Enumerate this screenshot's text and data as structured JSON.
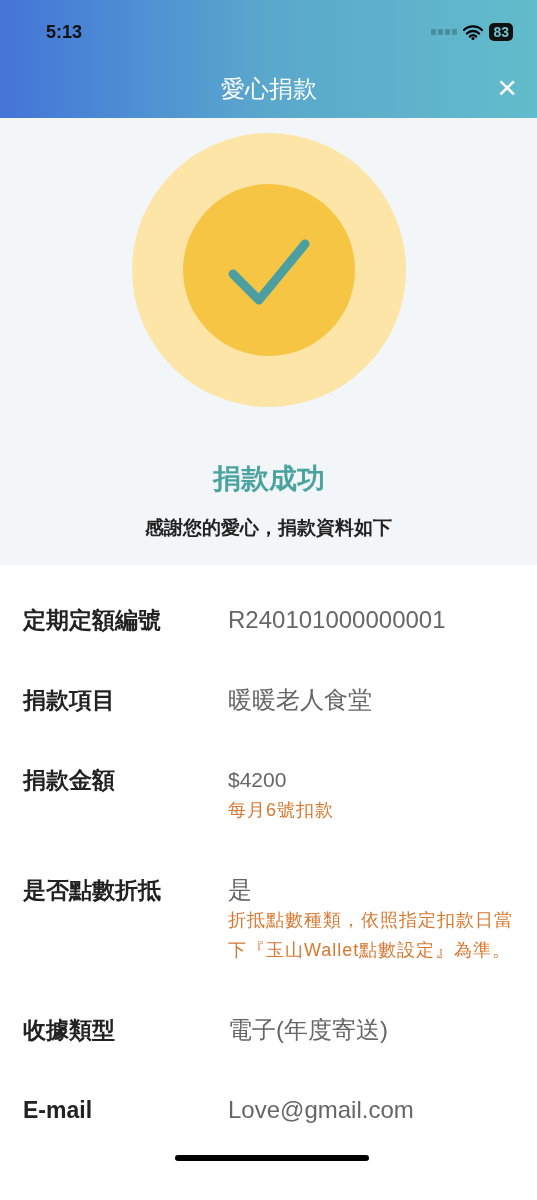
{
  "status_bar": {
    "time": "5:13",
    "battery": "83"
  },
  "header": {
    "title": "愛心捐款",
    "close": "×"
  },
  "result": {
    "title": "捐款成功",
    "message": "感謝您的愛心，捐款資料如下"
  },
  "details": [
    {
      "label": "定期定額編號",
      "value": "R240101000000001"
    },
    {
      "label": "捐款項目",
      "value": "暖暖老人食堂"
    },
    {
      "label": "捐款金額",
      "value": "$4200",
      "note": "每月6號扣款"
    },
    {
      "label": "是否點數折抵",
      "value": "是",
      "note": "折抵點數種類，依照指定扣款日當下『玉山Wallet點數設定』為準。"
    },
    {
      "label": "收據類型",
      "value": "電子(年度寄送)"
    },
    {
      "label": "E-mail",
      "value": "Love@gmail.com"
    }
  ]
}
